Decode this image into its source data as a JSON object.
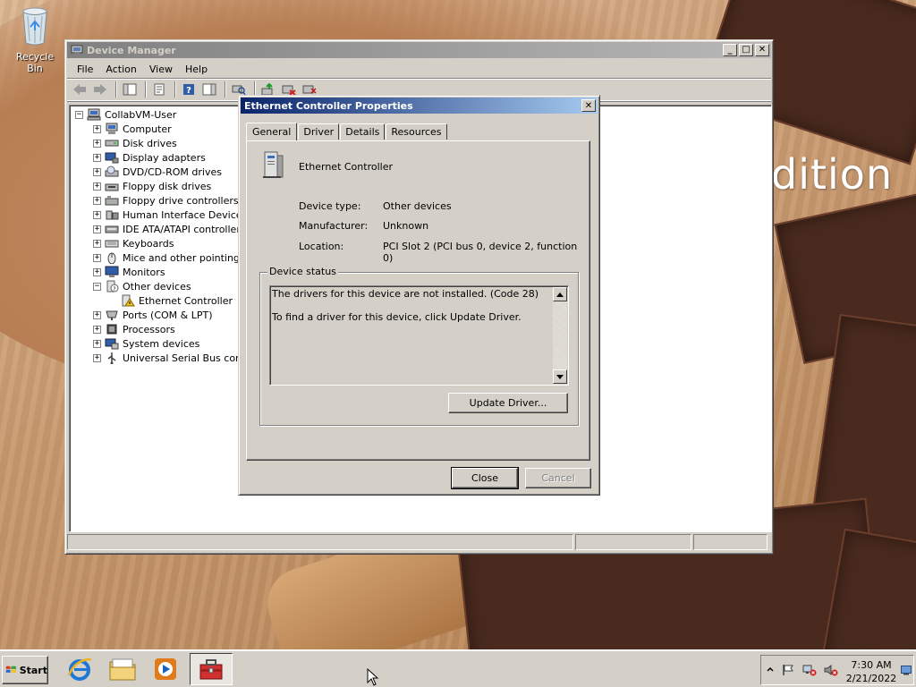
{
  "desktop": {
    "recycle_bin_label": "Recycle Bin",
    "wallpaper_text": "dition"
  },
  "device_manager": {
    "title": "Device Manager",
    "menu": [
      "File",
      "Action",
      "View",
      "Help"
    ],
    "title_buttons": {
      "minimize": "_",
      "maximize": "□",
      "close": "✕"
    },
    "tree": {
      "root": "CollabVM-User",
      "items": [
        {
          "label": "Computer",
          "icon": "computer-icon",
          "expanded": false
        },
        {
          "label": "Disk drives",
          "icon": "disk-drive-icon",
          "expanded": false
        },
        {
          "label": "Display adapters",
          "icon": "display-adapter-icon",
          "expanded": false
        },
        {
          "label": "DVD/CD-ROM drives",
          "icon": "dvd-drive-icon",
          "expanded": false
        },
        {
          "label": "Floppy disk drives",
          "icon": "floppy-icon",
          "expanded": false
        },
        {
          "label": "Floppy drive controllers",
          "icon": "floppy-controller-icon",
          "expanded": false
        },
        {
          "label": "Human Interface Devices",
          "icon": "hid-icon",
          "expanded": false
        },
        {
          "label": "IDE ATA/ATAPI controllers",
          "icon": "ide-controller-icon",
          "expanded": false
        },
        {
          "label": "Keyboards",
          "icon": "keyboard-icon",
          "expanded": false
        },
        {
          "label": "Mice and other pointing de",
          "icon": "mouse-icon",
          "expanded": false
        },
        {
          "label": "Monitors",
          "icon": "monitor-icon",
          "expanded": false
        },
        {
          "label": "Other devices",
          "icon": "unknown-device-icon",
          "expanded": true
        },
        {
          "label": "Ethernet Controller",
          "icon": "warning-device-icon",
          "child": true
        },
        {
          "label": "Ports (COM & LPT)",
          "icon": "port-icon",
          "expanded": false
        },
        {
          "label": "Processors",
          "icon": "processor-icon",
          "expanded": false
        },
        {
          "label": "System devices",
          "icon": "system-device-icon",
          "expanded": false
        },
        {
          "label": "Universal Serial Bus contro",
          "icon": "usb-icon",
          "expanded": false
        }
      ]
    }
  },
  "properties_dialog": {
    "title": "Ethernet Controller Properties",
    "close_glyph": "✕",
    "tabs": [
      "General",
      "Driver",
      "Details",
      "Resources"
    ],
    "selected_tab": "General",
    "device_name": "Ethernet Controller",
    "fields": {
      "device_type_label": "Device type:",
      "device_type_value": "Other devices",
      "manufacturer_label": "Manufacturer:",
      "manufacturer_value": "Unknown",
      "location_label": "Location:",
      "location_value": "PCI Slot 2 (PCI bus 0, device 2, function 0)"
    },
    "device_status": {
      "legend": "Device status",
      "line1": "The drivers for this device are not installed. (Code 28)",
      "line2": "To find a driver for this device, click Update Driver."
    },
    "buttons": {
      "update_driver": "Update Driver...",
      "close": "Close",
      "cancel": "Cancel"
    }
  },
  "taskbar": {
    "start_label": "Start",
    "clock_time": "7:30 AM",
    "clock_date": "2/21/2022"
  },
  "colors": {
    "active_title_start": "#0a246a",
    "active_title_end": "#a6caf0",
    "face": "#d4d0c8"
  }
}
